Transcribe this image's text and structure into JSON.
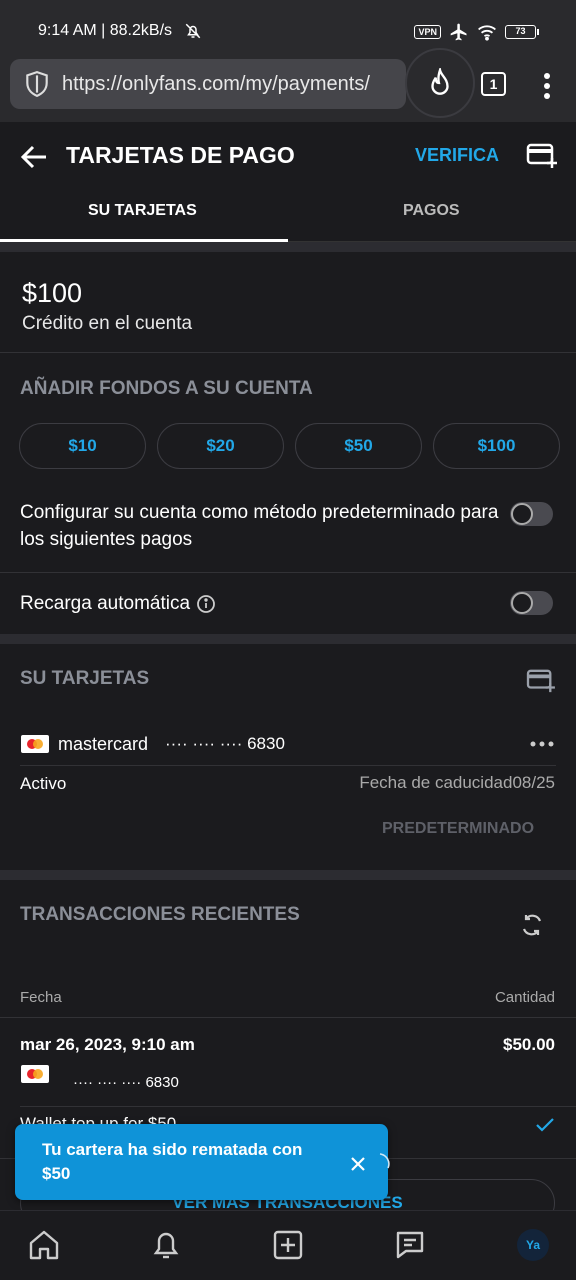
{
  "status_bar": {
    "time": "9:14 AM | 88.2kB/s",
    "vpn": "VPN",
    "battery": "73"
  },
  "browser": {
    "url": "https://onlyfans.com/my/payments/",
    "tab_count": "1"
  },
  "header": {
    "title": "TARJETAS DE PAGO",
    "verify": "VERIFICA"
  },
  "tabs": [
    {
      "label": "SU TARJETAS",
      "active": true
    },
    {
      "label": "PAGOS",
      "active": false
    }
  ],
  "balance": {
    "amount": "$100",
    "label": "Crédito en el cuenta"
  },
  "add_funds": {
    "heading": "AÑADIR FONDOS A SU CUENTA",
    "amounts": [
      "$10",
      "$20",
      "$50",
      "$100"
    ],
    "default_method_label": "Configurar su cuenta como método predeterminado para los siguientes pagos",
    "auto_recharge_label": "Recarga automática"
  },
  "cards": {
    "heading": "SU TARJETAS",
    "items": [
      {
        "brand": "mastercard",
        "masked_number": "···· ···· ···· 6830",
        "status": "Activo",
        "expiry": "Fecha de caducidad08/25",
        "action": "PREDETERMINADO"
      }
    ]
  },
  "transactions": {
    "heading": "TRANSACCIONES RECIENTES",
    "columns": [
      "Fecha",
      "Cantidad"
    ],
    "rows": [
      {
        "date": "mar 26, 2023, 9:10 am",
        "amount": "$50.00",
        "card": "···· ···· ···· 6830",
        "description": "Wallet top up for $50"
      }
    ],
    "more_button": "VER MAS TRANSACCIONES"
  },
  "toast": {
    "message": "Tu cartera ha sido rematada con $50"
  },
  "bottom_nav": {
    "avatar": "Ya"
  },
  "colors": {
    "accent": "#22a8e8",
    "background": "#1b1b1e",
    "toast": "#0f93d8"
  }
}
